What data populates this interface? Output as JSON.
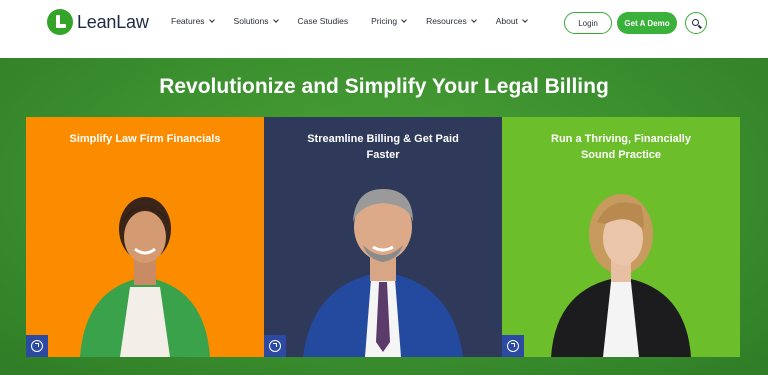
{
  "header": {
    "logo_text": "LeanLaw",
    "nav": [
      {
        "label": "Features",
        "has_menu": true
      },
      {
        "label": "Solutions",
        "has_menu": true
      },
      {
        "label": "Case Studies",
        "has_menu": false
      },
      {
        "label": "Pricing",
        "has_menu": true
      },
      {
        "label": "Resources",
        "has_menu": true
      },
      {
        "label": "About",
        "has_menu": true
      }
    ],
    "login_label": "Login",
    "demo_label": "Get A Demo",
    "search_icon": "search-icon"
  },
  "hero": {
    "title": "Revolutionize and Simplify Your Legal Billing",
    "cards": [
      {
        "title": "Simplify Law Firm Financials",
        "color": "#fb8c00"
      },
      {
        "title": "Streamline Billing & Get Paid Faster",
        "color": "#2f3a5b"
      },
      {
        "title": "Run a Thriving, Financially Sound Practice",
        "color": "#6cbf2a"
      }
    ]
  },
  "colors": {
    "brand_green": "#3ab13a",
    "link_badge": "#2d4aa3"
  }
}
